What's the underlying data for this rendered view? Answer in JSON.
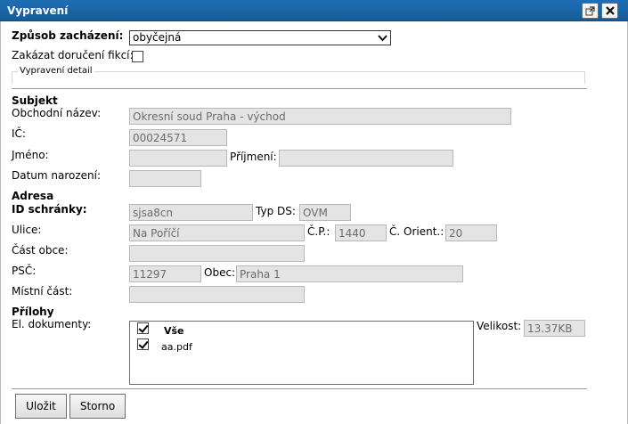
{
  "window": {
    "title": "Vypravení"
  },
  "form": {
    "sending_method": {
      "label": "Způsob zacházení:",
      "value": "obyčejná"
    },
    "no_fiction_delivery": {
      "label": "Zakázat doručení fikcí:",
      "checked": false
    },
    "detail_legend": "Vypravení detail",
    "subject": {
      "heading": "Subjekt",
      "business_name": {
        "label": "Obchodní název:",
        "value": "Okresní soud Praha - východ"
      },
      "ic": {
        "label": "IČ:",
        "value": "00024571"
      },
      "first_name": {
        "label": "Jméno:",
        "value": ""
      },
      "last_name": {
        "label": "Příjmení:",
        "value": ""
      },
      "birth_date": {
        "label": "Datum narození:",
        "value": ""
      }
    },
    "address": {
      "heading": "Adresa",
      "databox_id": {
        "label": "ID schránky:",
        "value": "sjsa8cn"
      },
      "ds_type": {
        "label": "Typ DS:",
        "value": "OVM"
      },
      "street": {
        "label": "Ulice:",
        "value": "Na Poříčí"
      },
      "cp": {
        "label": "Č.P.:",
        "value": "1440"
      },
      "orient": {
        "label": "Č. Orient.:",
        "value": "20"
      },
      "district_part": {
        "label": "Část obce:",
        "value": ""
      },
      "psc": {
        "label": "PSČ:",
        "value": "11297"
      },
      "municipality": {
        "label": "Obec:",
        "value": "Praha 1"
      },
      "local_part": {
        "label": "Místní část:",
        "value": ""
      }
    },
    "attachments": {
      "heading": "Přílohy",
      "documents_label": "El. dokumenty:",
      "all_label": "Vše",
      "all_checked": true,
      "files": [
        {
          "name": "aa.pdf",
          "checked": true
        }
      ],
      "size": {
        "label": "Velikost:",
        "value": "13.37KB"
      }
    }
  },
  "buttons": {
    "save": "Uložit",
    "cancel": "Storno"
  }
}
